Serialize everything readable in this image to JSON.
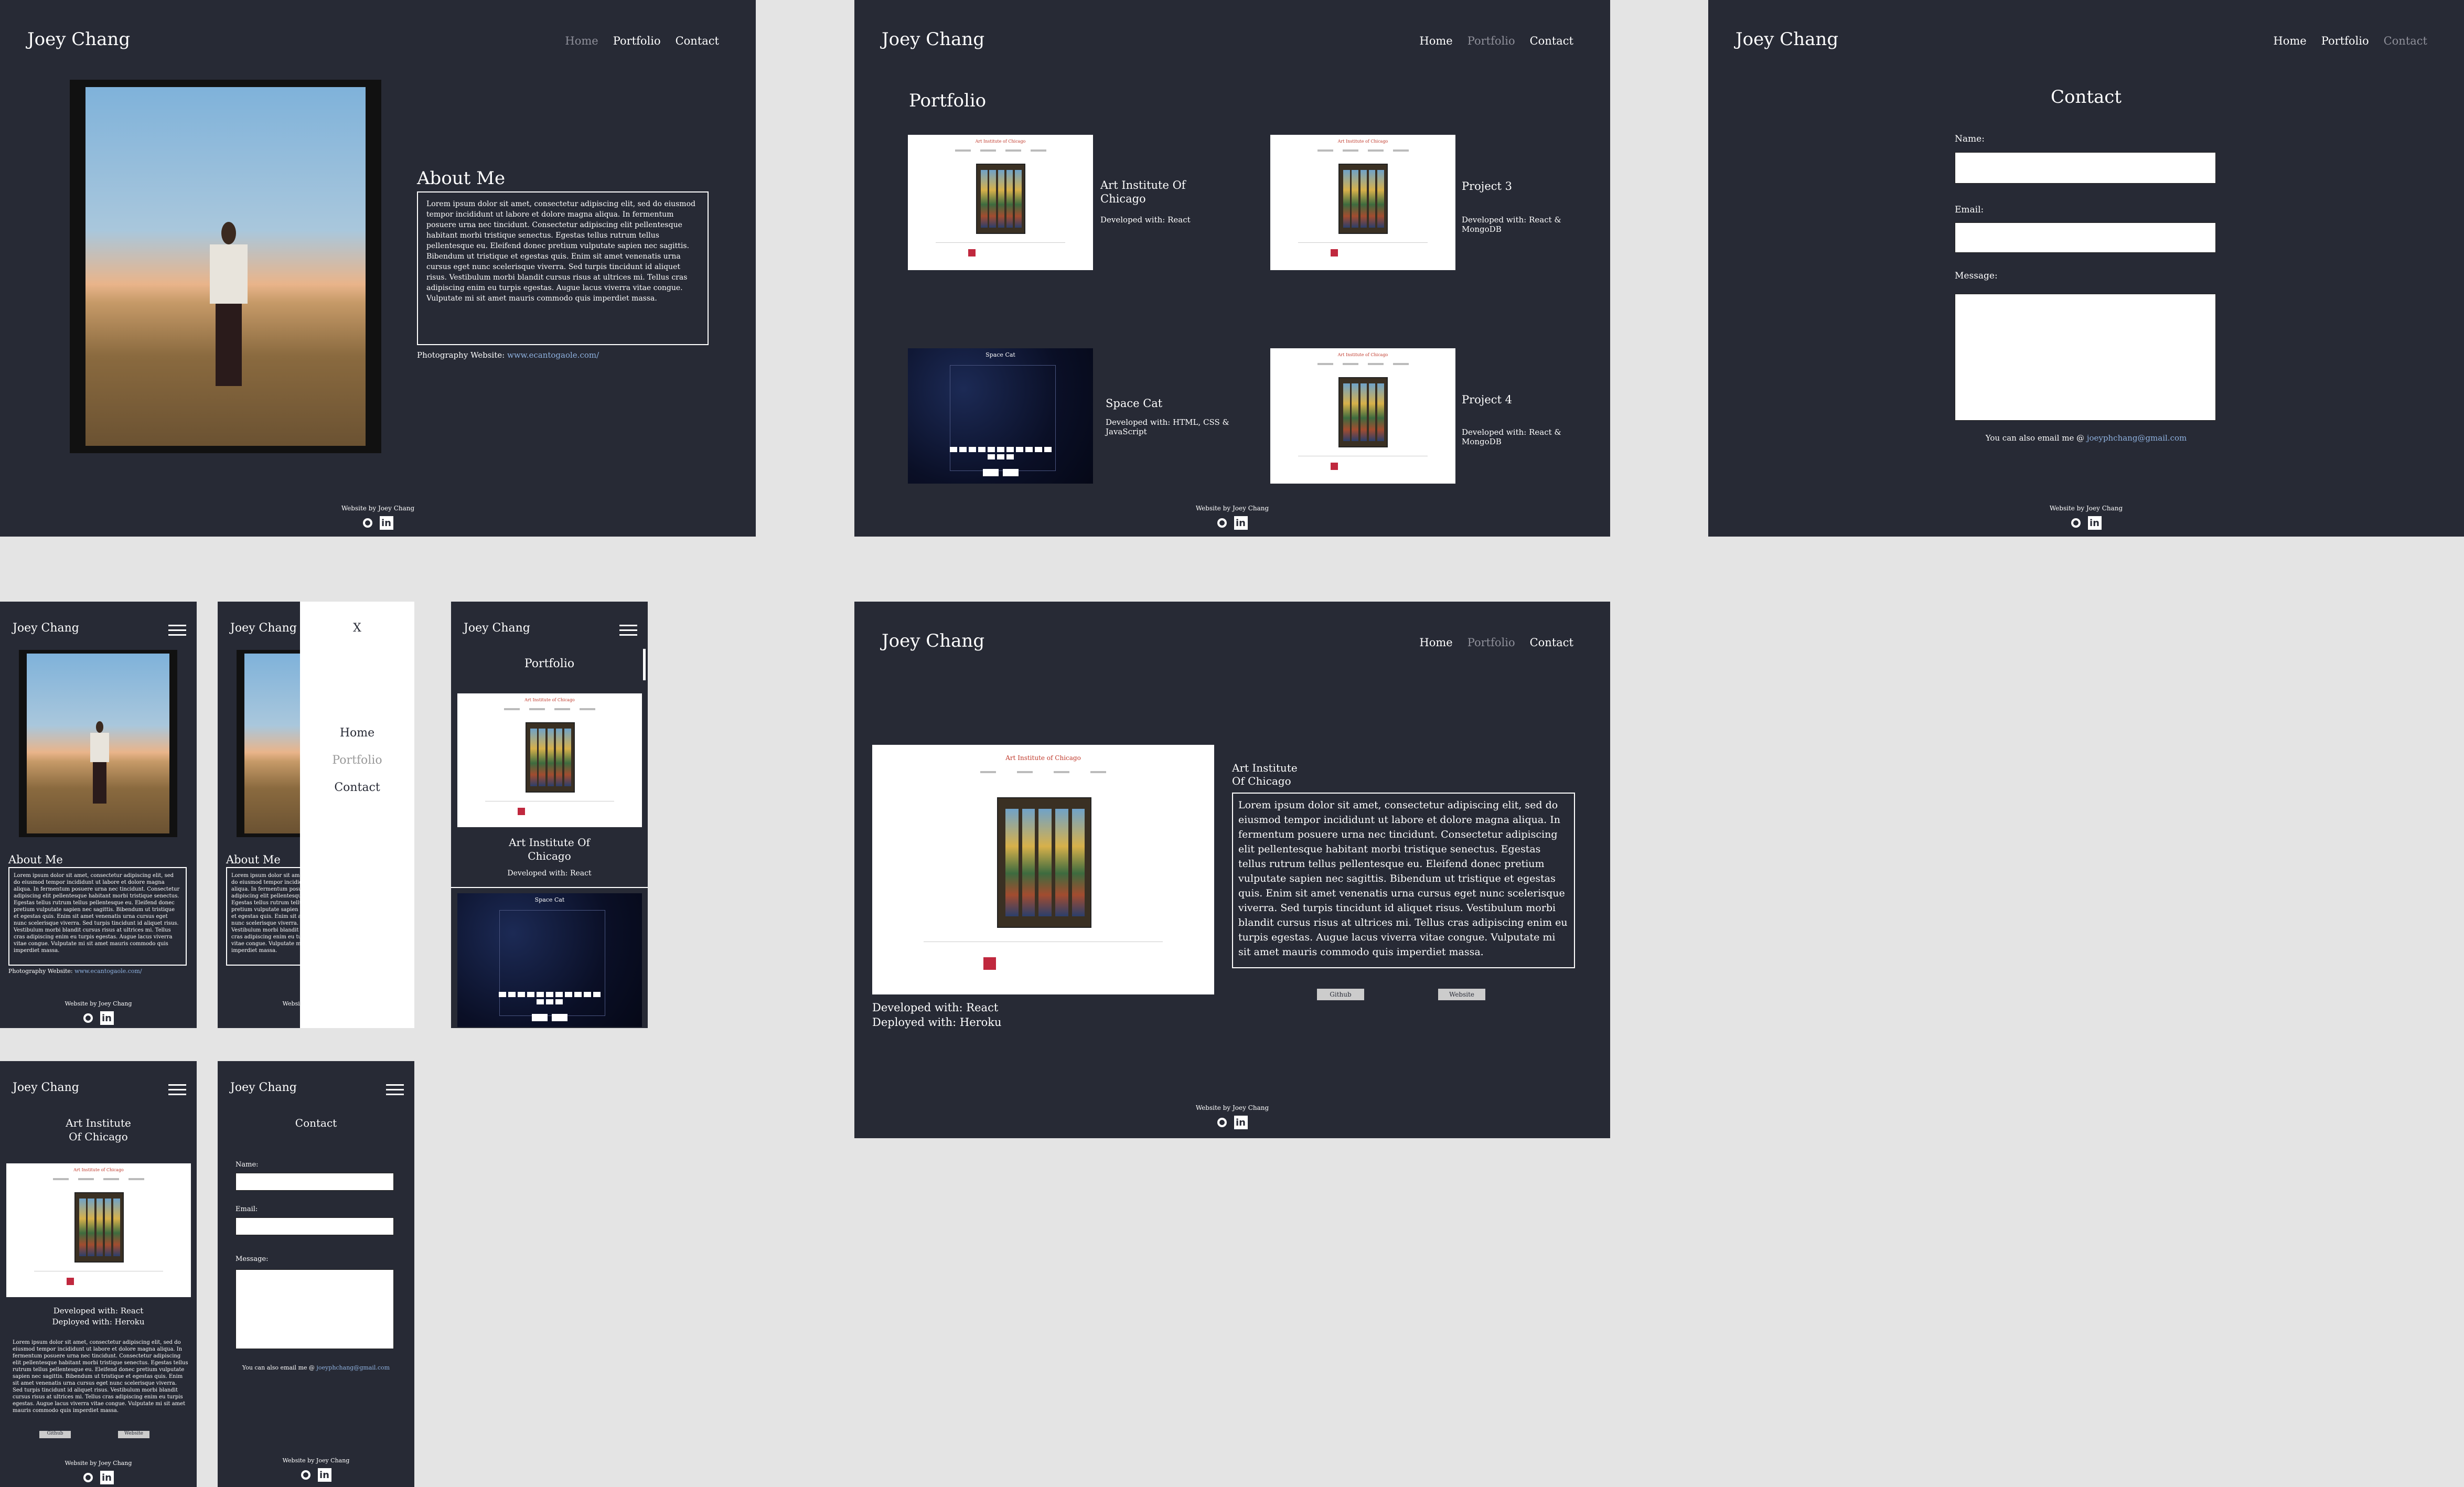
{
  "brand": "Joey Chang",
  "nav": {
    "home": "Home",
    "portfolio": "Portfolio",
    "contact": "Contact"
  },
  "footer": {
    "credit": "Website by Joey Chang"
  },
  "about": {
    "heading": "About Me",
    "body": "Lorem ipsum dolor sit amet, consectetur adipiscing elit, sed do eiusmod tempor incididunt ut labore et dolore magna aliqua. In fermentum posuere urna nec tincidunt. Consectetur adipiscing elit pellentesque habitant morbi tristique senectus. Egestas tellus rutrum tellus pellentesque eu. Eleifend donec pretium vulputate sapien nec sagittis. Bibendum ut tristique et egestas quis. Enim sit amet venenatis urna cursus eget nunc scelerisque viverra. Sed turpis tincidunt id aliquet risus. Vestibulum morbi blandit cursus risus at ultrices mi. Tellus cras adipiscing enim eu turpis egestas. Augue lacus viverra vitae congue. Vulputate mi sit amet mauris commodo quis imperdiet massa.",
    "photo_label": "Photography Website:",
    "photo_link": "www.ecantogaole.com/"
  },
  "portfolio": {
    "heading": "Portfolio",
    "projects": [
      {
        "title": "Art Institute Of Chicago",
        "dev": "Developed with: React"
      },
      {
        "title": "Project 3",
        "dev": "Developed with: React & MongoDB"
      },
      {
        "title": "Space Cat",
        "dev": "Developed with: HTML, CSS & JavaScript"
      },
      {
        "title": "Project 4",
        "dev": "Developed with: React & MongoDB"
      }
    ],
    "thumb_title": "Art Institute of Chicago",
    "space_title": "Space Cat"
  },
  "contact": {
    "heading": "Contact",
    "name_label": "Name:",
    "email_label": "Email:",
    "message_label": "Message:",
    "also_email": "You can also email me @",
    "email": "joeyphchang@gmail.com"
  },
  "detail": {
    "title_line1": "Art Institute",
    "title_line2": "Of Chicago",
    "dev": "Developed with: React",
    "deploy": "Deployed with: Heroku",
    "github": "Github",
    "website": "Website"
  },
  "menu": {
    "close": "X"
  },
  "icons": [
    "github-icon",
    "linkedin-icon",
    "hamburger-icon"
  ],
  "colors": {
    "panel": "#272a35",
    "canvas": "#e4e4e4",
    "active_nav": "#8f909a",
    "link": "#8fb2e0"
  }
}
